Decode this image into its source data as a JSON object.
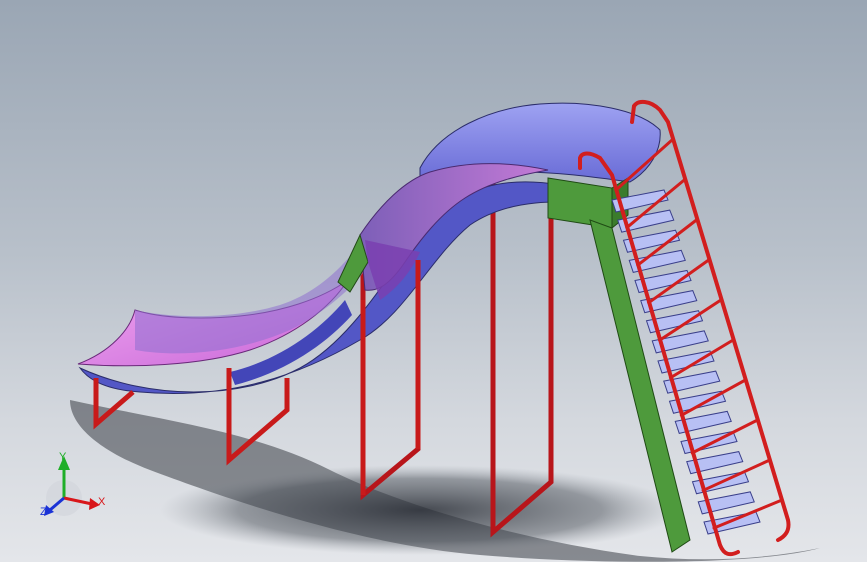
{
  "view": {
    "background_top": "#9aa6b4",
    "background_bottom": "#e4e6ea"
  },
  "model": {
    "parts": [
      {
        "name": "slide-chute",
        "colors": [
          "#e58ee8",
          "#6b6fdc",
          "#7c84e6"
        ]
      },
      {
        "name": "ladder-stringer",
        "color": "#4e9a3c"
      },
      {
        "name": "ladder-steps",
        "color": "#b8c0f4"
      },
      {
        "name": "handrails",
        "color": "#d21e1e"
      },
      {
        "name": "support-frames",
        "color": "#c81a1a"
      }
    ]
  },
  "triad": {
    "x_label": "X",
    "y_label": "Y",
    "z_label": "Z",
    "x_color": "#d8161a",
    "y_color": "#1fae28",
    "z_color": "#1b33d6"
  }
}
